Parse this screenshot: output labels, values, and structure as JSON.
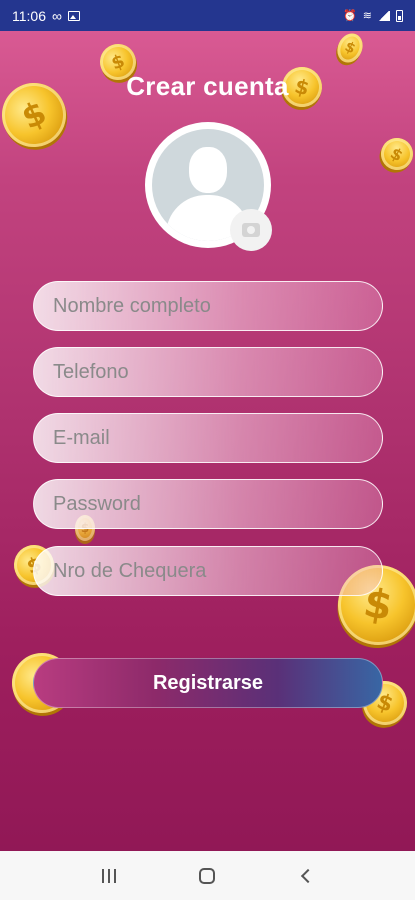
{
  "status_bar": {
    "time": "11:06",
    "left_icons": [
      "voicemail-icon",
      "image-icon"
    ],
    "right_icons": [
      "alarm-icon",
      "wifi-icon",
      "signal-icon",
      "battery-icon"
    ],
    "background": "#24368f"
  },
  "screen": {
    "title": "Crear cuenta",
    "avatar": {
      "icon": "user-placeholder-icon",
      "action_icon": "camera-icon"
    },
    "fields": [
      {
        "name": "full-name",
        "placeholder": "Nombre completo",
        "value": ""
      },
      {
        "name": "phone",
        "placeholder": "Telefono",
        "value": ""
      },
      {
        "name": "email",
        "placeholder": "E-mail",
        "value": ""
      },
      {
        "name": "password",
        "placeholder": "Password",
        "value": ""
      },
      {
        "name": "checkbook-number",
        "placeholder": "Nro de Chequera",
        "value": ""
      }
    ],
    "register_label": "Registrarse",
    "decorations": {
      "coin_symbol": "$",
      "coin_color": "#f7c42c"
    }
  },
  "nav_bar": {
    "buttons": [
      "recents-icon",
      "home-icon",
      "back-icon"
    ]
  },
  "colors": {
    "bg_top": "#d95a93",
    "bg_bottom": "#911856",
    "button_start": "#b83c80",
    "button_end": "#3866a4"
  }
}
